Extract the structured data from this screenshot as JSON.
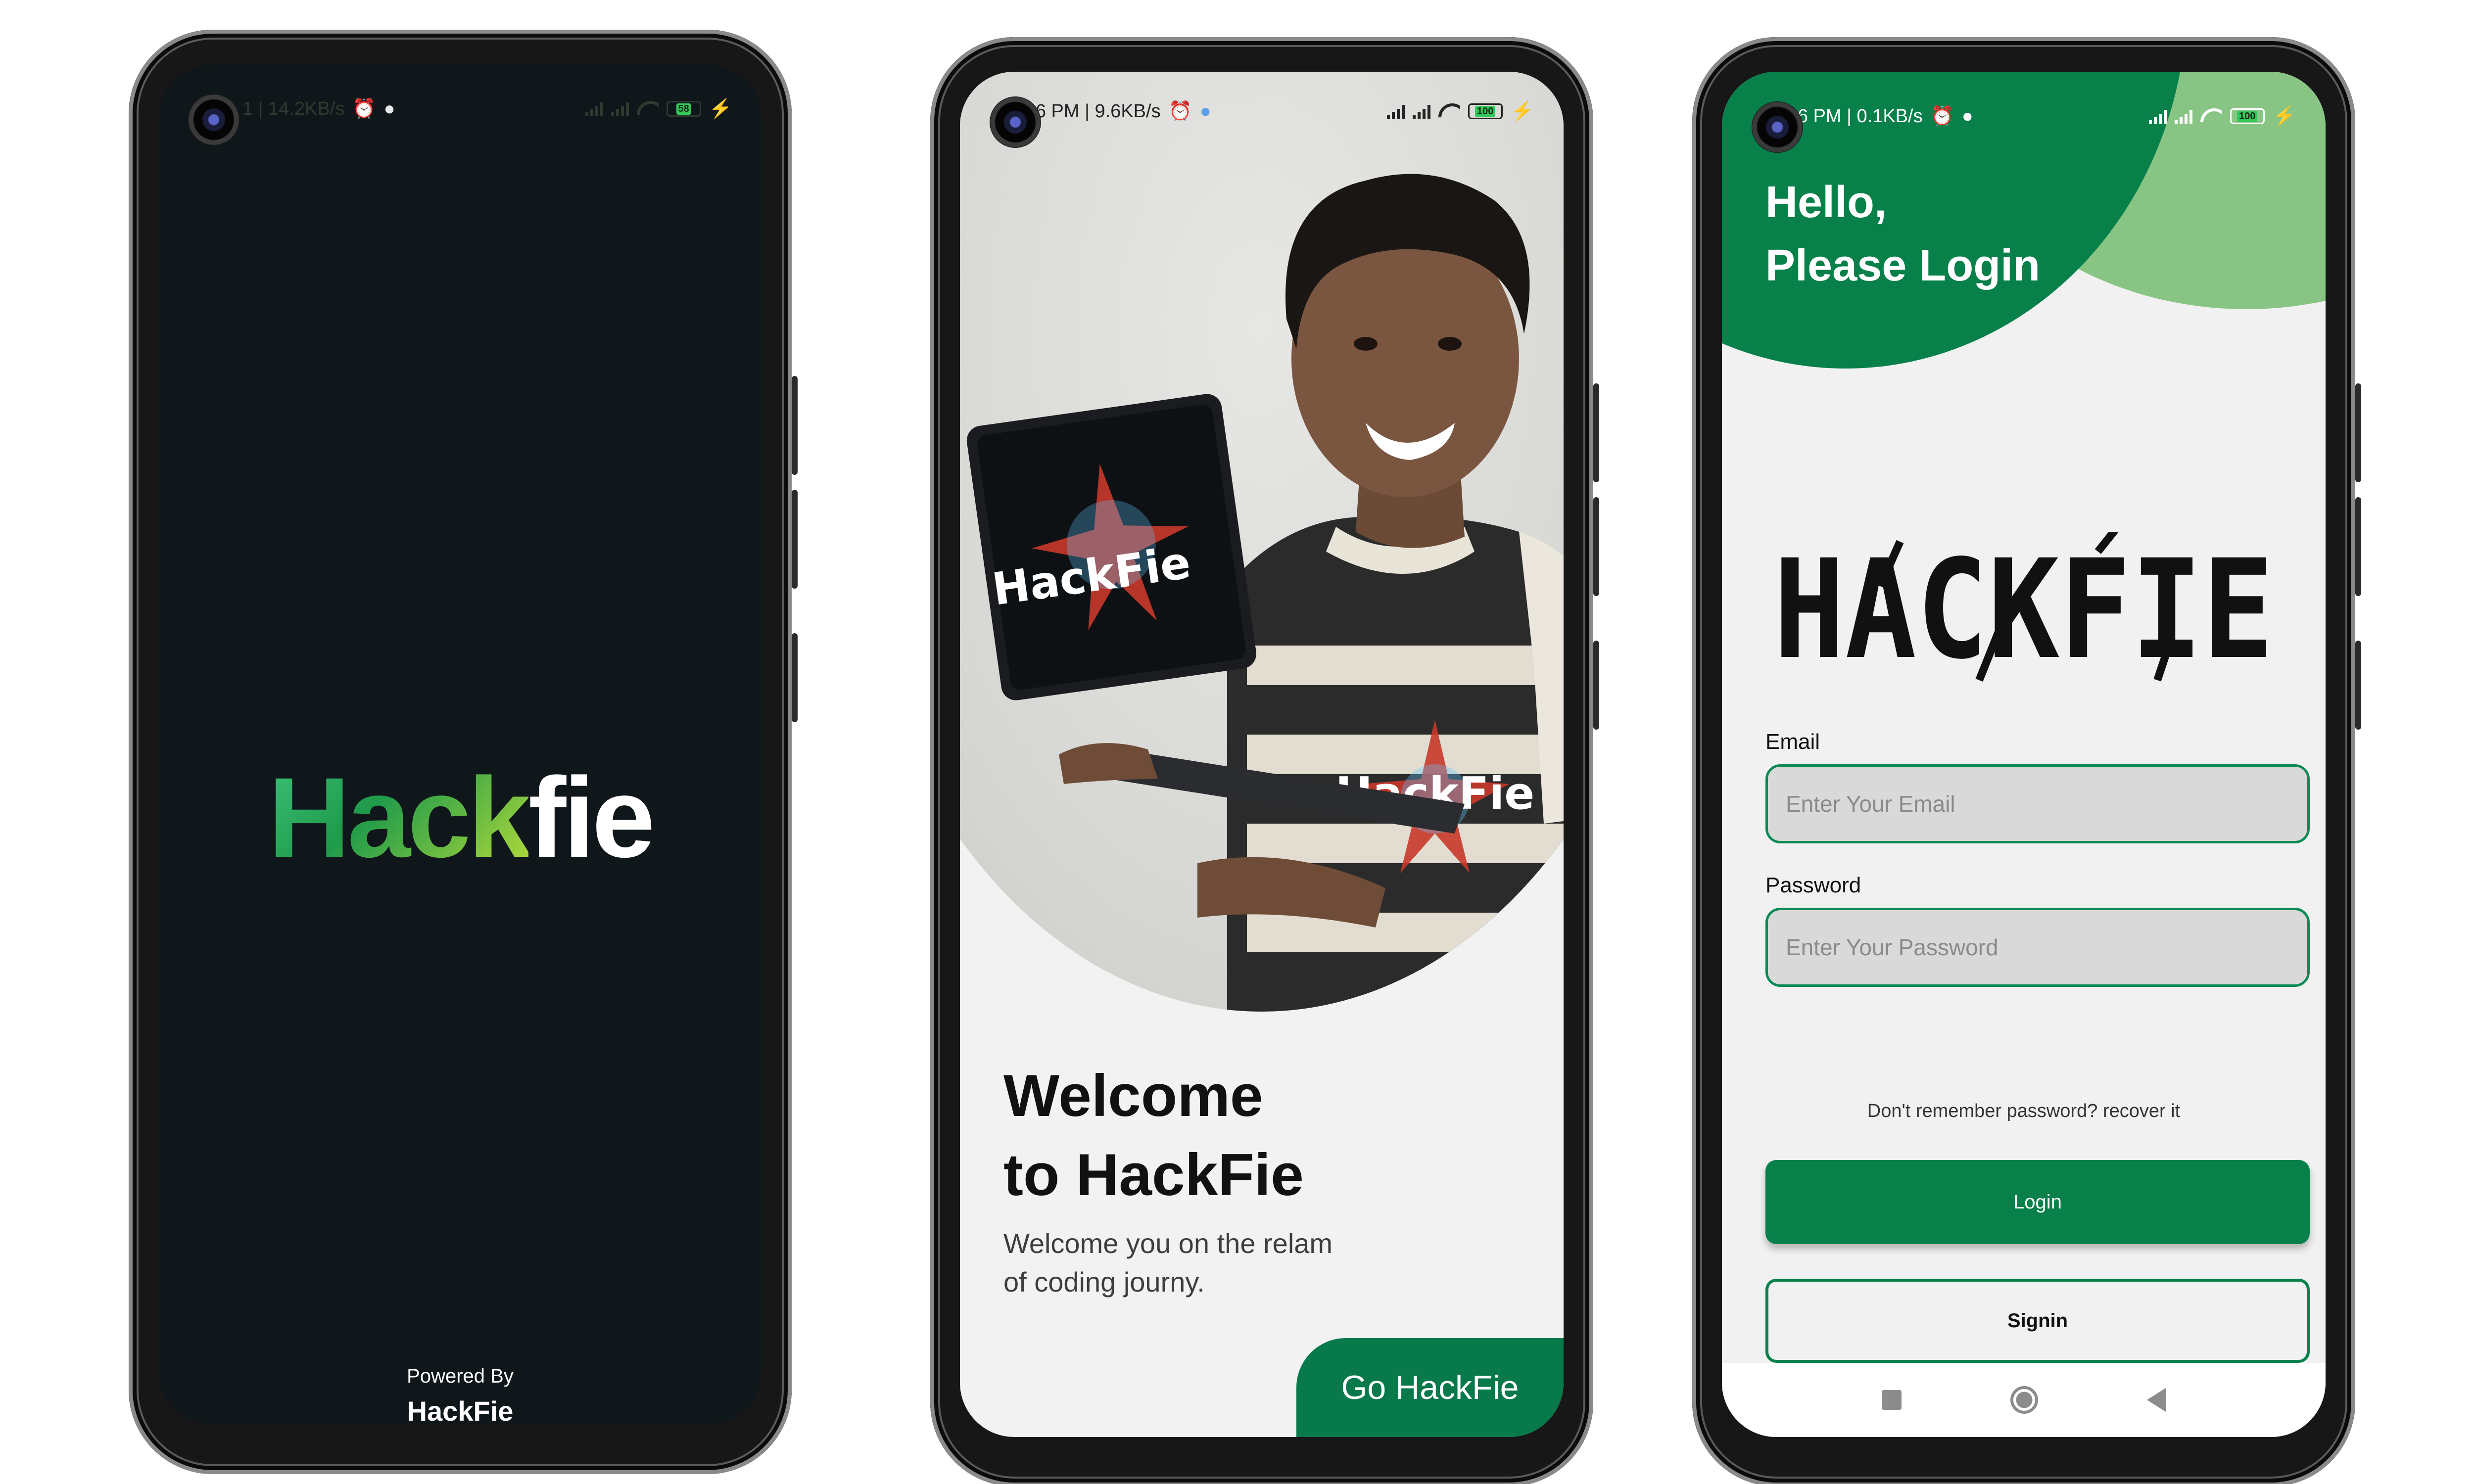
{
  "phones": {
    "splash": {
      "status": {
        "left": "1 | 14.2KB/s",
        "battery": "58"
      },
      "logo": {
        "green_part": "Hack",
        "white_part": "fie"
      },
      "powered_by": "Powered By",
      "powered_brand": "HackFie"
    },
    "welcome": {
      "status": {
        "left": "6:26 PM | 9.6KB/s",
        "battery": "100"
      },
      "shirt_logo": "HackFie",
      "laptop_logo": "HackFie",
      "title_line1": "Welcome",
      "title_line2": "to HackFie",
      "subtitle_line1": "Welcome you on the relam",
      "subtitle_line2": "of coding journy.",
      "go_button": "Go HackFie"
    },
    "login": {
      "status": {
        "left": "6:26 PM | 0.1KB/s",
        "battery": "100"
      },
      "greeting_line1": "Hello,",
      "greeting_line2": "Please Login",
      "brand_mark": "HACKFIE",
      "email_label": "Email",
      "email_placeholder": "Enter Your Email",
      "password_label": "Password",
      "password_placeholder": "Enter Your Password",
      "recover_text": "Don't remember password? recover it",
      "login_button": "Login",
      "signin_button": "Signin"
    }
  },
  "colors": {
    "brand_green": "#07804a",
    "light_green": "#88c585",
    "splash_bg": "#10171b",
    "screen_bg": "#f2f2f2"
  },
  "icons": [
    "camera-icon",
    "alarm-icon",
    "signal-icon",
    "wifi-icon",
    "battery-icon",
    "charging-icon",
    "nav-recents-icon",
    "nav-home-icon",
    "nav-back-icon"
  ]
}
